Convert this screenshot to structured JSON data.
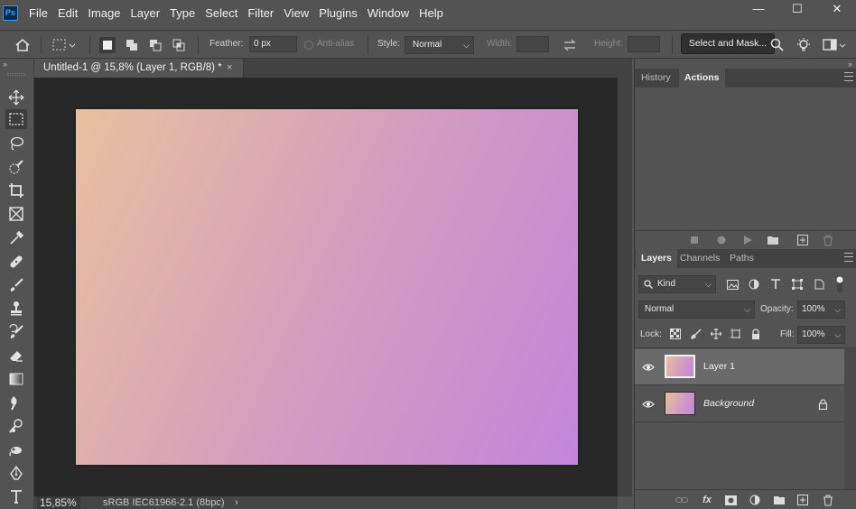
{
  "app": {
    "logo": "Ps"
  },
  "menu": [
    "File",
    "Edit",
    "Image",
    "Layer",
    "Type",
    "Select",
    "Filter",
    "View",
    "Plugins",
    "Window",
    "Help"
  ],
  "window_controls": {
    "minimize": "—",
    "maximize": "☐",
    "close": "✕"
  },
  "options": {
    "feather_label": "Feather:",
    "feather_value": "0 px",
    "antialias_label": "Anti-alias",
    "style_label": "Style:",
    "style_value": "Normal",
    "width_label": "Width:",
    "height_label": "Height:",
    "select_mask_label": "Select and Mask..."
  },
  "document": {
    "tab_title": "Untitled-1 @ 15,8% (Layer 1, RGB/8) *",
    "close_glyph": "×",
    "zoom": "15,85%",
    "doc_info": "sRGB IEC61966-2.1 (8bpc)",
    "status_arrow": "›"
  },
  "colors": {
    "gradient_start": "#e8c09e",
    "gradient_mid": "#d098c4",
    "gradient_end": "#c386da",
    "panel_bg": "#535353",
    "workspace_bg": "#282828"
  },
  "history_panel": {
    "tabs": [
      "History",
      "Actions"
    ],
    "active_tab": "Actions"
  },
  "layers_panel": {
    "tabs": [
      "Layers",
      "Channels",
      "Paths"
    ],
    "active_tab": "Layers",
    "filter_kind": "Kind",
    "blend_mode": "Normal",
    "opacity_label": "Opacity:",
    "opacity_value": "100%",
    "lock_label": "Lock:",
    "fill_label": "Fill:",
    "fill_value": "100%",
    "layers": [
      {
        "name": "Layer 1",
        "selected": true,
        "locked": false
      },
      {
        "name": "Background",
        "selected": false,
        "locked": true
      }
    ]
  },
  "tools": [
    "move-icon",
    "marquee-icon",
    "lasso-icon",
    "quick-select-icon",
    "crop-icon",
    "frame-icon",
    "eyedropper-icon",
    "healing-icon",
    "brush-icon",
    "stamp-icon",
    "history-brush-icon",
    "eraser-icon",
    "gradient-icon",
    "blur-icon",
    "dodge-icon",
    "smudge-icon",
    "pen-icon",
    "type-icon"
  ]
}
